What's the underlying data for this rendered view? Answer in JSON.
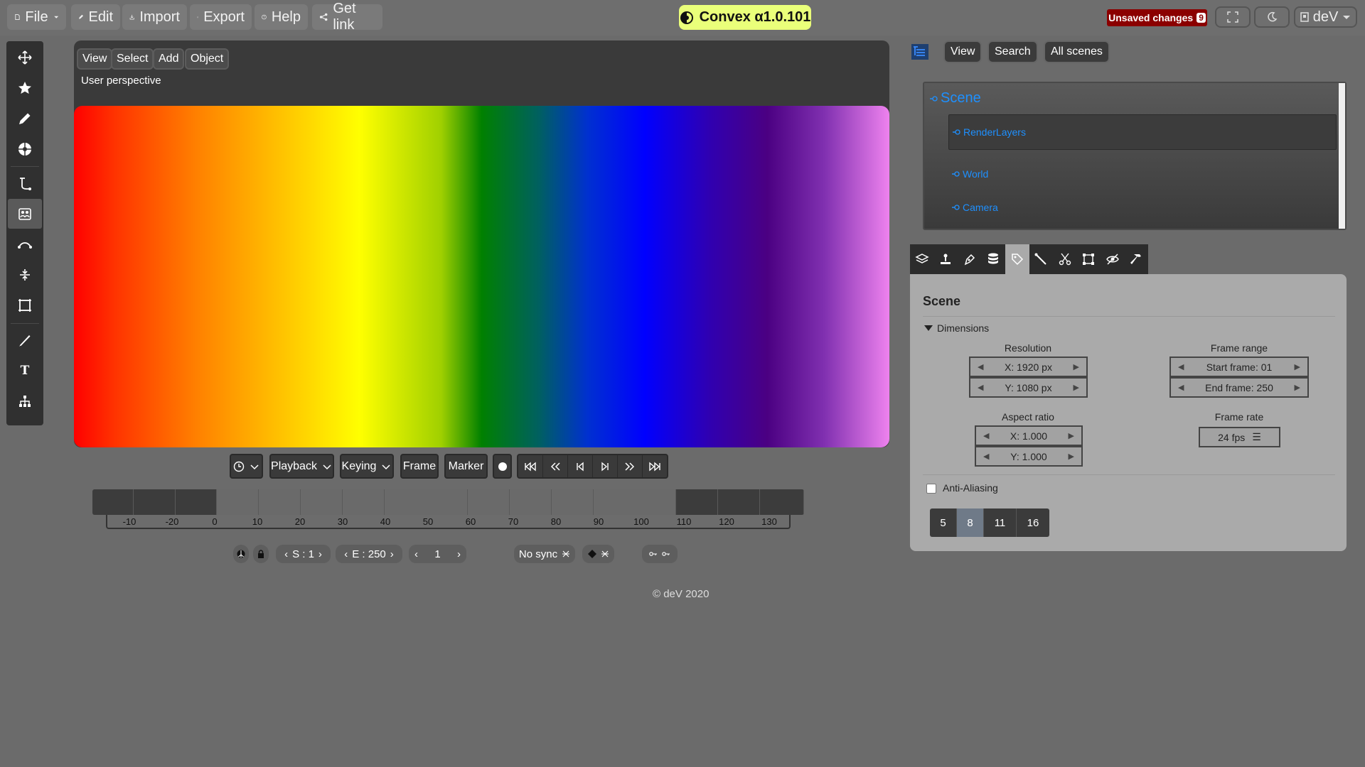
{
  "topbar": {
    "menus": [
      {
        "label": "File",
        "icon": "file-icon"
      },
      {
        "label": "Edit",
        "icon": "pencil-icon"
      },
      {
        "label": "Import",
        "icon": "import-icon"
      },
      {
        "label": "Export",
        "icon": "export-icon"
      },
      {
        "label": "Help",
        "icon": "help-icon"
      },
      {
        "label": "Get link",
        "icon": "share-icon"
      }
    ],
    "app_title": "Convex α1.0.101",
    "unsaved_label": "Unsaved changes",
    "unsaved_count": "9",
    "user_label": "deV",
    "colors": {
      "title_bg": "#eaff7a",
      "unsaved_bg": "#8b0000"
    }
  },
  "left_toolbar": {
    "tools": [
      "move-icon",
      "star-icon",
      "pencil-icon",
      "sphere-icon",
      "bezier-icon",
      "people-icon",
      "curve-icon",
      "align-icon",
      "crop-icon",
      "brush-icon",
      "text-icon",
      "hierarchy-icon"
    ],
    "active_tool": "people-icon",
    "text_tool_glyph": "T"
  },
  "viewport": {
    "menu": [
      "View",
      "Select",
      "Add",
      "Object"
    ],
    "perspective_label": "User perspective"
  },
  "transport": {
    "playback": "Playback",
    "keying": "Keying",
    "frame": "Frame",
    "marker": "Marker"
  },
  "timeline": {
    "ticks": [
      "-10",
      "-20",
      "0",
      "10",
      "20",
      "30",
      "40",
      "50",
      "60",
      "70",
      "80",
      "90",
      "100",
      "110",
      "120",
      "130"
    ]
  },
  "bottom_controls": {
    "start": "S : 1",
    "end": "E : 250",
    "current": "1",
    "sync": "No sync"
  },
  "footer": "© deV 2020",
  "right_panel": {
    "buttons": [
      "View",
      "Search",
      "All scenes"
    ],
    "outliner": {
      "scene": "Scene",
      "items": [
        "RenderLayers",
        "World",
        "Camera"
      ]
    },
    "props": {
      "heading": "Scene",
      "section": "Dimensions",
      "resolution_label": "Resolution",
      "res_x": "X: 1920 px",
      "res_y": "Y: 1080 px",
      "frame_range_label": "Frame range",
      "start_frame": "Start frame: 01",
      "end_frame": "End frame: 250",
      "aspect_label": "Aspect ratio",
      "aspect_x": "X: 1.000",
      "aspect_y": "Y: 1.000",
      "frame_rate_label": "Frame rate",
      "frame_rate": "24 fps",
      "antialias_label": "Anti-Aliasing",
      "antialias_options": [
        "5",
        "8",
        "11",
        "16"
      ],
      "antialias_selected": "8"
    }
  }
}
